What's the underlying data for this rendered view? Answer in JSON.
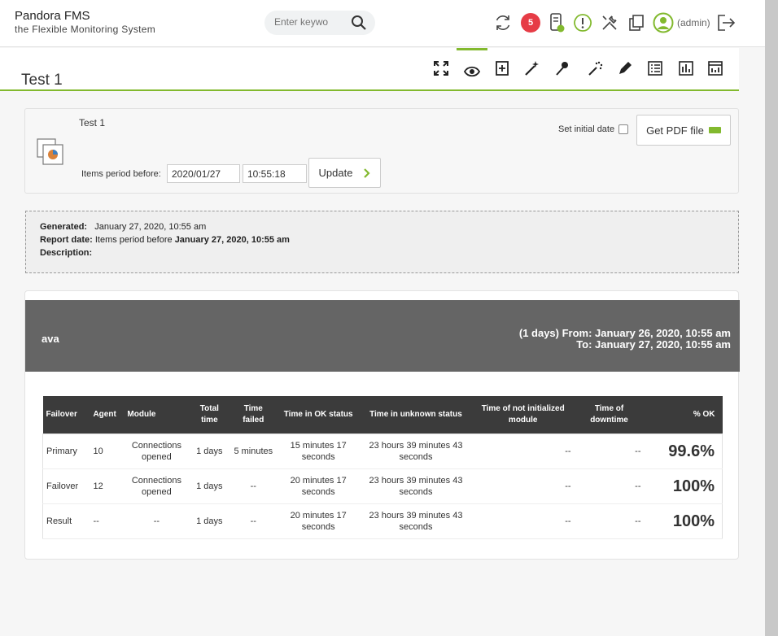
{
  "header": {
    "brand_name": "Pandora FMS",
    "brand_tagline": "the Flexible Monitoring System",
    "search_placeholder": "Enter keywo",
    "notification_count": "5",
    "user_label": "(admin)"
  },
  "page": {
    "title": "Test 1",
    "toolbar": [
      "fullscreen-icon",
      "eye-icon",
      "add-item-icon",
      "wizard-icon",
      "pin-icon",
      "sla-wizard-icon",
      "edit-icon",
      "list-items-icon",
      "report-icon",
      "report-advanced-icon"
    ]
  },
  "controls": {
    "report_name": "Test 1",
    "period_label": "Items period before:",
    "date_value": "2020/01/27",
    "time_value": "10:55:18",
    "update_label": "Update",
    "initial_date_label": "Set initial date",
    "pdf_label": "Get PDF file"
  },
  "info": {
    "generated_label": "Generated:",
    "generated_value": "January 27, 2020, 10:55 am",
    "report_date_label": "Report date:",
    "report_date_prefix": "Items period before",
    "report_date_value": "January 27, 2020, 10:55 am",
    "description_label": "Description:"
  },
  "report": {
    "agent": "ava",
    "range_from": "(1 days) From: January 26, 2020, 10:55 am",
    "range_to": "To: January 27, 2020, 10:55 am",
    "columns": [
      "Failover",
      "Agent",
      "Module",
      "Total time",
      "Time failed",
      "Time in OK status",
      "Time in unknown status",
      "Time of not initialized module",
      "Time of downtime",
      "% OK"
    ],
    "rows": [
      {
        "failover": "Primary",
        "agent": "10",
        "module": "Connections opened",
        "total": "1 days",
        "failed": "5 minutes",
        "ok": "15 minutes 17 seconds",
        "unknown": "23 hours 39 minutes 43 seconds",
        "notinit": "--",
        "downtime": "--",
        "pct": "99.6%"
      },
      {
        "failover": "Failover",
        "agent": "12",
        "module": "Connections opened",
        "total": "1 days",
        "failed": "--",
        "ok": "20 minutes 17 seconds",
        "unknown": "23 hours 39 minutes 43 seconds",
        "notinit": "--",
        "downtime": "--",
        "pct": "100%"
      },
      {
        "failover": "Result",
        "agent": "--",
        "module": "--",
        "total": "1 days",
        "failed": "--",
        "ok": "20 minutes 17 seconds",
        "unknown": "23 hours 39 minutes 43 seconds",
        "notinit": "--",
        "downtime": "--",
        "pct": "100%"
      }
    ]
  },
  "colors": {
    "accent": "#82b92e",
    "alert": "#e63c46",
    "panel_head": "#656565",
    "table_head": "#3b3b3b"
  }
}
